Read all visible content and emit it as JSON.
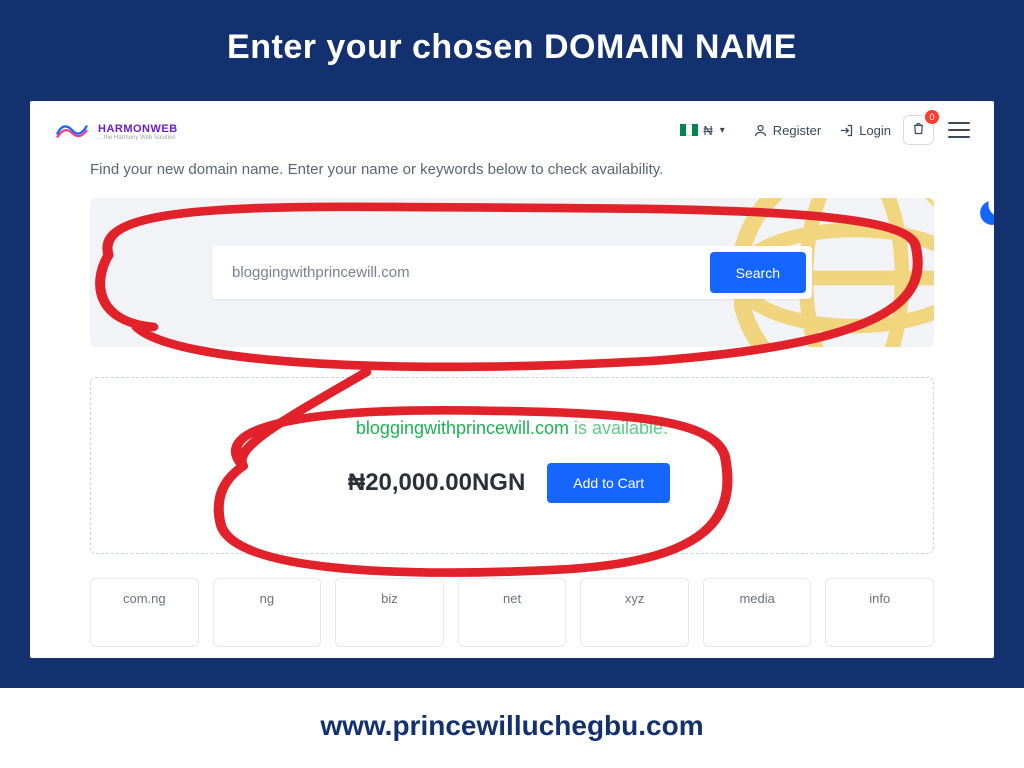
{
  "frame": {
    "heading": "Enter your chosen DOMAIN NAME",
    "footer_url": "www.princewilluchegbu.com"
  },
  "topbar": {
    "brand_name": "HARMONWEB",
    "brand_tagline": "…the Harmony Web Solution",
    "currency_label": "₦",
    "register_label": "Register",
    "login_label": "Login",
    "cart_count": "0"
  },
  "page": {
    "intro": "Find your new domain name. Enter your name or keywords below to check availability.",
    "search_value": "bloggingwithprincewill.com",
    "search_button": "Search"
  },
  "result": {
    "domain": "bloggingwithprincewill.com",
    "available_suffix": " is available.",
    "price": "₦20,000.00NGN",
    "add_to_cart": "Add to Cart"
  },
  "tlds": [
    "com.ng",
    "ng",
    "biz",
    "net",
    "xyz",
    "media",
    "info"
  ]
}
